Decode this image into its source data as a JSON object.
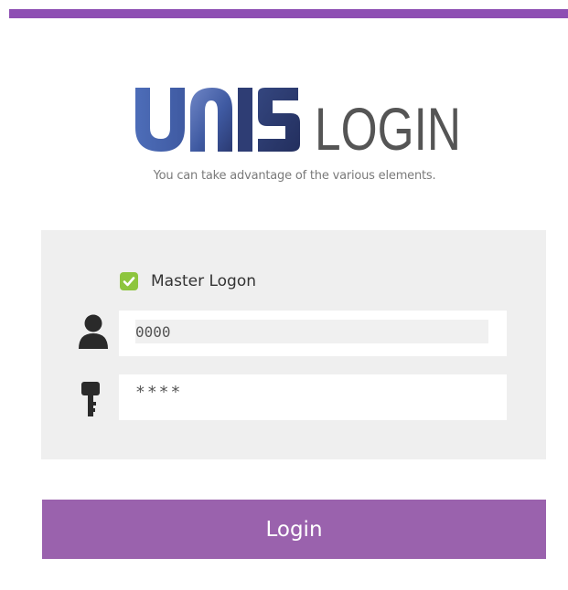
{
  "header": {
    "logo_brand": "UNIS",
    "logo_word": "LOGIN",
    "tagline": "You can take advantage of the various elements."
  },
  "form": {
    "master_logon_label": "Master Logon",
    "master_logon_checked": true,
    "user_id": {
      "value": "0000",
      "icon": "user-icon"
    },
    "password": {
      "value": "****",
      "icon": "key-icon"
    },
    "login_button_label": "Login"
  },
  "colors": {
    "accent_bar": "#8e4fb3",
    "login_button": "#9a62ad",
    "checkbox": "#8dc53e",
    "panel": "#efefef",
    "logo_blue": "#3f5ea6",
    "logo_navy": "#2b3a72",
    "logo_text": "#555555"
  }
}
